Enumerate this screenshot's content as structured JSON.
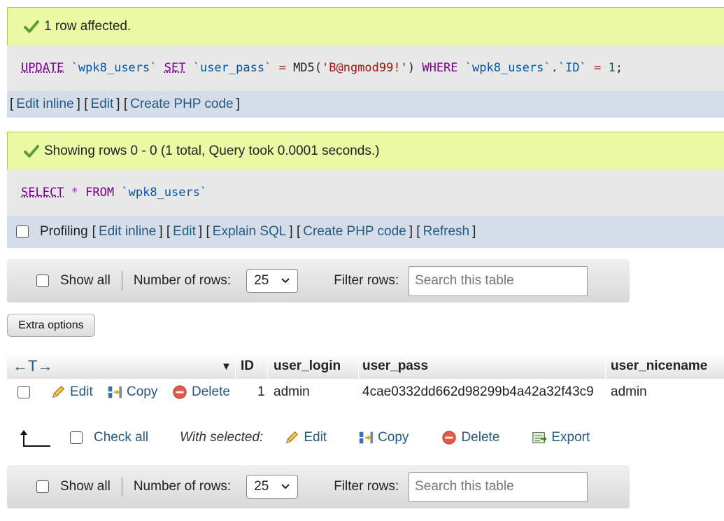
{
  "update_message": {
    "text": "1 row affected.",
    "sql": {
      "update": "UPDATE",
      "table": "`wpk8_users`",
      "set": "SET",
      "column": "`user_pass`",
      "eq": "=",
      "func": "MD5(",
      "value": "'B@ngmod99!'",
      "close": ")",
      "where": "WHERE",
      "where_table": "`wpk8_users`",
      "dot": ".",
      "where_col": "`ID`",
      "eq2": "=",
      "num": "1",
      "semi": ";"
    },
    "links": {
      "open1": "[",
      "edit_inline": "Edit inline",
      "sep1": "] [",
      "edit": "Edit",
      "sep2": "] [",
      "create_php": "Create PHP code",
      "close": "]"
    }
  },
  "select_message": {
    "text": "Showing rows 0 - 0 (1 total, Query took 0.0001 seconds.)",
    "sql": {
      "select": "SELECT",
      "star": "*",
      "from": "FROM",
      "table": "`wpk8_users`"
    },
    "links": {
      "profiling": "Profiling",
      "open1": "[",
      "edit_inline": "Edit inline",
      "sep1": "] [",
      "edit": "Edit",
      "sep2": "] [",
      "explain": "Explain SQL",
      "sep3": "] [",
      "create_php": "Create PHP code",
      "sep4": "] [",
      "refresh": "Refresh",
      "close": "]"
    }
  },
  "navigation": {
    "show_all": "Show all",
    "number_of_rows_label": "Number of rows:",
    "rows_value": "25",
    "filter_label": "Filter rows:",
    "search_placeholder": "Search this table"
  },
  "extra_options": "Extra options",
  "table": {
    "arrows": "←T→",
    "sort_icon": "▼",
    "columns": [
      "ID",
      "user_login",
      "user_pass",
      "user_nicename"
    ],
    "rows": [
      {
        "edit": "Edit",
        "copy": "Copy",
        "delete": "Delete",
        "id": "1",
        "user_login": "admin",
        "user_pass": "4cae0332dd662d98299b4a42a32f43c9",
        "user_nicename": "admin"
      }
    ]
  },
  "bulk_actions": {
    "check_all": "Check all",
    "with_selected": "With selected:",
    "edit": "Edit",
    "copy": "Copy",
    "delete": "Delete",
    "export": "Export"
  },
  "colors": {
    "success_bg": "#ebf8a4",
    "link": "#235a81",
    "sql_keyword": "#770088",
    "sql_identifier": "#0055aa",
    "sql_string": "#aa1111",
    "linkbar_bg": "#d5dee8"
  },
  "icons": [
    "check-icon",
    "pencil-icon",
    "copy-icon",
    "delete-icon",
    "export-icon",
    "chevron-down-icon",
    "arrow-up-corner-icon"
  ]
}
